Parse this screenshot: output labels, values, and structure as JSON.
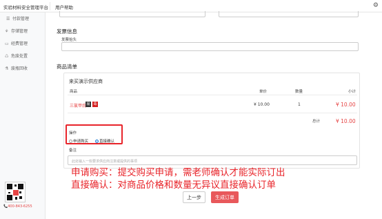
{
  "topbar": {
    "brand": "实验材料安全管理平台",
    "help": "用户帮助",
    "settings_icon": "gear-icon"
  },
  "sidebar": {
    "items": [
      {
        "label": "付款管理",
        "icon": "list-icon"
      },
      {
        "label": "存储管理",
        "icon": "sitemap-icon"
      },
      {
        "label": "经费管理",
        "icon": "card-icon"
      },
      {
        "label": "危废处置",
        "icon": "recycle-icon"
      },
      {
        "label": "废瓶回收",
        "icon": "flask-icon"
      }
    ],
    "phone": "400-843-6255"
  },
  "invoice": {
    "title": "发票信息",
    "header_label": "发票抬头",
    "header_value": ""
  },
  "goods": {
    "title": "商品清单",
    "supplier": "来买演示供应商",
    "columns": {
      "product": "商品",
      "price": "单价",
      "qty": "数量",
      "subtotal": "小计"
    },
    "rows": [
      {
        "name": "三氯甲烷",
        "price": "¥ 10.00",
        "qty": "1",
        "subtotal": "¥ 10.00",
        "tags": [
          "易",
          "毒"
        ]
      }
    ],
    "total_label": "总计",
    "total_value": "¥ 10.00"
  },
  "operation": {
    "label": "操作",
    "options": [
      {
        "label": "申请购买",
        "selected": false
      },
      {
        "label": "直接确认",
        "selected": true
      }
    ]
  },
  "remark": {
    "label": "备注",
    "placeholder": "此处输入一些要求供应商注意或提供的事项"
  },
  "annotation": {
    "line1": "申请购买：提交购买申请，需老师确认才能实际订出",
    "line2": "直接确认：对商品价格和数量无异议直接确认订单"
  },
  "buttons": {
    "prev": "上一步",
    "submit": "生成订单"
  },
  "colors": {
    "accent_red": "#e8242a",
    "price_red": "#e64545",
    "submit_bg": "#e8585b",
    "radio_blue": "#1e7bd6"
  }
}
